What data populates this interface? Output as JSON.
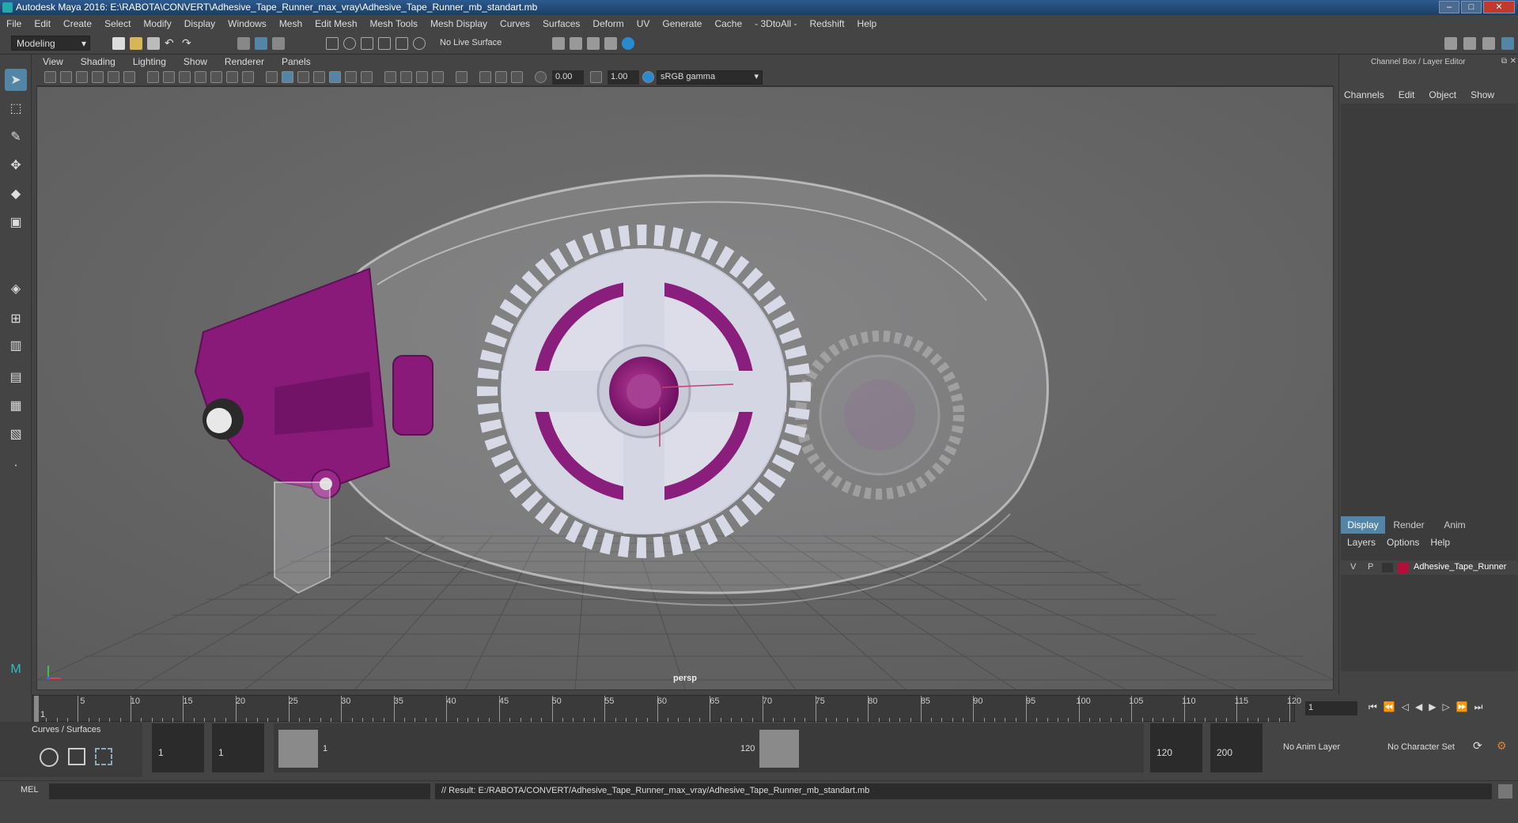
{
  "window": {
    "title": "Autodesk Maya 2016: E:\\RABOTA\\CONVERT\\Adhesive_Tape_Runner_max_vray\\Adhesive_Tape_Runner_mb_standart.mb"
  },
  "menus": [
    "File",
    "Edit",
    "Create",
    "Select",
    "Modify",
    "Display",
    "Windows",
    "Mesh",
    "Edit Mesh",
    "Mesh Tools",
    "Mesh Display",
    "Curves",
    "Surfaces",
    "Deform",
    "UV",
    "Generate",
    "Cache",
    "- 3DtoAll -",
    "Redshift",
    "Help"
  ],
  "statusline": {
    "mode": "Modeling",
    "live_surface": "No Live Surface"
  },
  "panel_menus": [
    "View",
    "Shading",
    "Lighting",
    "Show",
    "Renderer",
    "Panels"
  ],
  "panel_toolbar": {
    "exposure": "0.00",
    "gamma": "1.00",
    "color_space": "sRGB gamma"
  },
  "viewport": {
    "camera": "persp"
  },
  "channel_box": {
    "title": "Channel Box / Layer Editor",
    "menus": [
      "Channels",
      "Edit",
      "Object",
      "Show"
    ]
  },
  "layer_editor": {
    "tabs": [
      "Display",
      "Render",
      "Anim"
    ],
    "menus": [
      "Layers",
      "Options",
      "Help"
    ],
    "layers": [
      {
        "v": "V",
        "p": "P",
        "name": "Adhesive_Tape_Runner",
        "color": "#b0103a"
      }
    ]
  },
  "time_slider": {
    "current_frame": "1",
    "ticks": [
      "5",
      "10",
      "15",
      "20",
      "25",
      "30",
      "35",
      "40",
      "45",
      "50",
      "55",
      "60",
      "65",
      "70",
      "75",
      "80",
      "85",
      "90",
      "95",
      "100",
      "105",
      "110",
      "115",
      "120"
    ]
  },
  "range": {
    "shelf_tab": "Curves / Surfaces",
    "start": "1",
    "playback_start": "1",
    "slider_start": "1",
    "slider_end": "120",
    "playback_end": "120",
    "end": "200",
    "anim_layer": "No Anim Layer",
    "character_set": "No Character Set"
  },
  "command_line": {
    "language": "MEL",
    "result": "// Result: E:/RABOTA/CONVERT/Adhesive_Tape_Runner_max_vray/Adhesive_Tape_Runner_mb_standart.mb"
  },
  "colors": {
    "accent": "#5285a6",
    "magenta": "#8e1a78",
    "bg": "#444444",
    "viewport_bg": "#6a6a6a"
  }
}
